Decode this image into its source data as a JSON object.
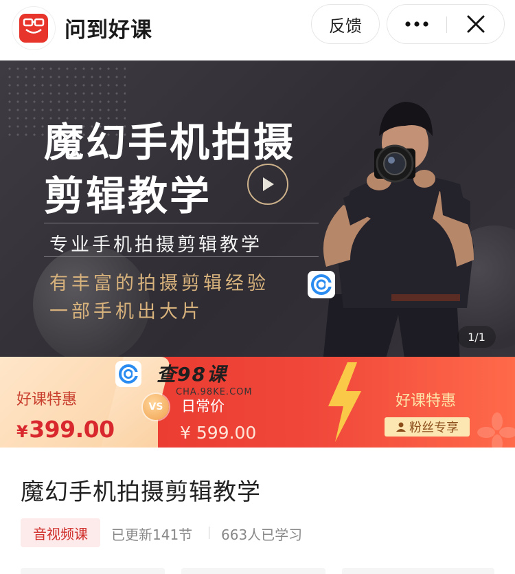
{
  "header": {
    "app_title": "问到好课",
    "logo_text": "问到好课",
    "feedback_label": "反馈",
    "more_icon": "more-dots-icon",
    "close_icon": "close-icon"
  },
  "banner": {
    "title_line1": "魔幻手机拍摄",
    "title_line2": "剪辑教学",
    "subtitle": "专业手机拍摄剪辑教学",
    "highlight_line1": "有丰富的拍摄剪辑经验",
    "highlight_line2": "一部手机出大片",
    "pager": "1/1",
    "colors": {
      "background": "#353339",
      "accent": "#d8b27c"
    }
  },
  "price_band": {
    "watermark_text": "查98课",
    "watermark_url": "CHA.98KE.COM",
    "special_label": "好课特惠",
    "special_price_symbol": "¥",
    "special_price": "399.00",
    "vs_label": "VS",
    "daily_label": "日常价",
    "daily_price": "¥ 599.00",
    "right_title": "好课特惠",
    "fans_badge": "粉丝专享",
    "colors": {
      "red": "#e6322a",
      "peach": "#fbd2a5",
      "gold": "#fde3a8"
    }
  },
  "course": {
    "title": "魔幻手机拍摄剪辑教学",
    "tag": "音视频课",
    "updated": "已更新141节",
    "learners": "663人已学习"
  }
}
